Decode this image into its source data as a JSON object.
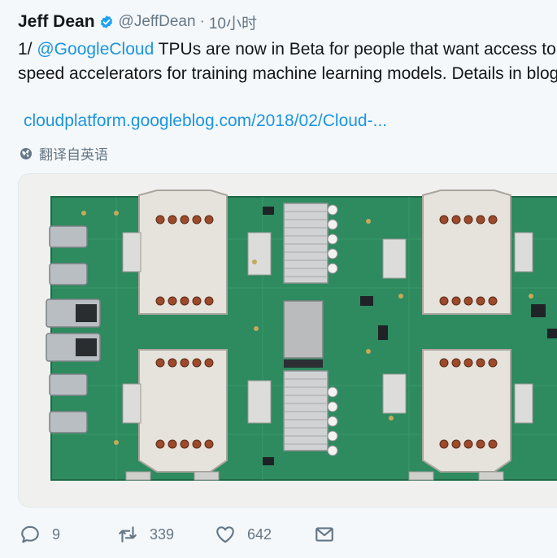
{
  "author": {
    "name": "Jeff Dean",
    "handle": "@JeffDean",
    "separator": "·",
    "time": "10小时"
  },
  "tweet": {
    "line1_prefix": "1/ ",
    "mention": "@GoogleCloud",
    "line1_rest": " TPUs are now in Beta for people that want access to h",
    "line2": "speed accelerators for training machine learning models.  Details in blog",
    "link": "cloudplatform.googleblog.com/2018/02/Cloud-...",
    "translate_label": "翻译自英语"
  },
  "actions": {
    "replies": "9",
    "retweets": "339",
    "likes": "642"
  },
  "colors": {
    "link": "#1b95e0",
    "muted": "#657786",
    "verified": "#1da1f2",
    "pcb": "#2e8a5f"
  },
  "icons": [
    "verified-badge-icon",
    "globe-icon",
    "reply-icon",
    "retweet-icon",
    "like-icon",
    "message-icon"
  ]
}
